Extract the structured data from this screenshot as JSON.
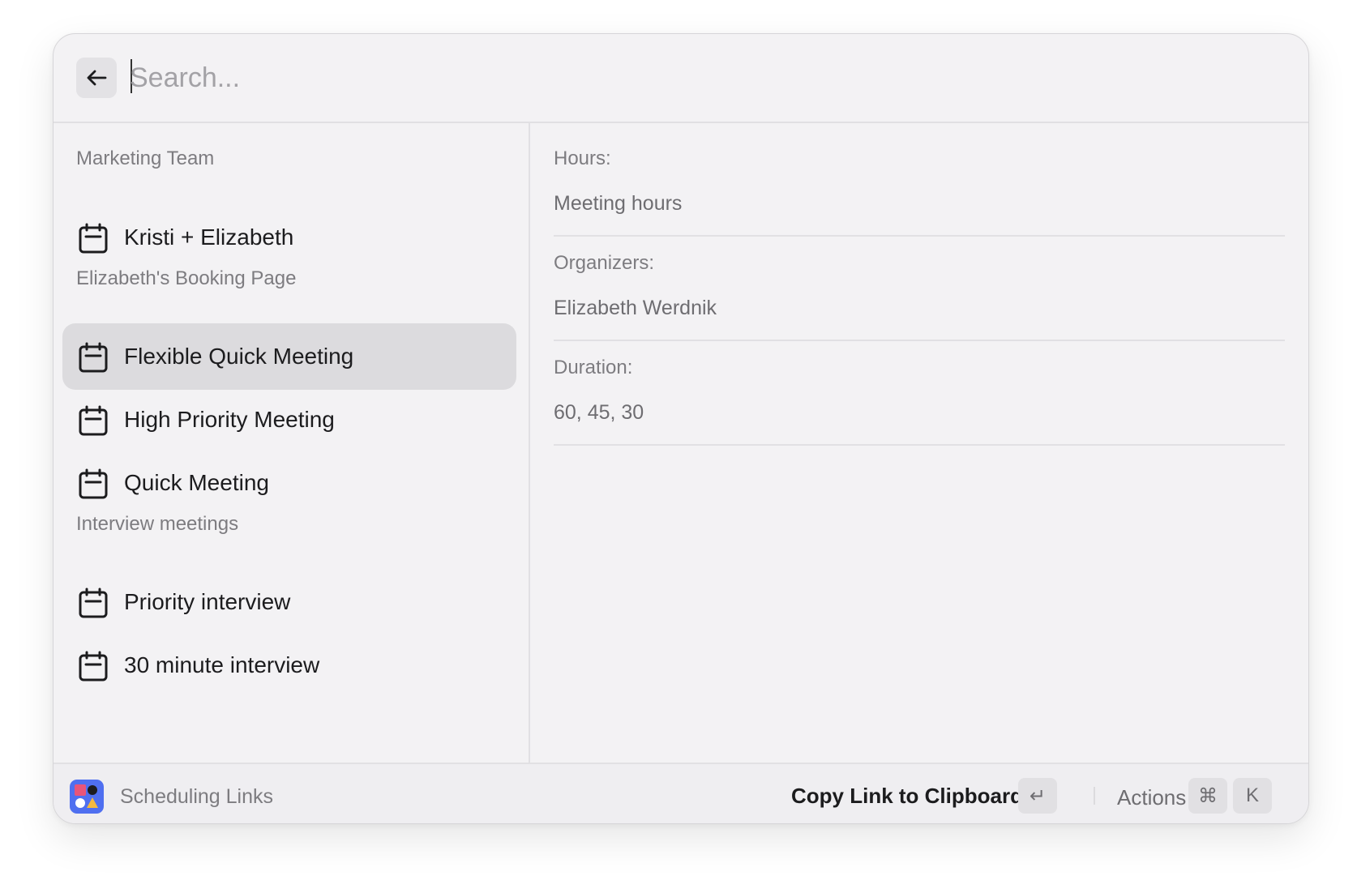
{
  "search": {
    "placeholder": "Search..."
  },
  "list": {
    "sections": [
      {
        "title": "Marketing Team",
        "items": [
          {
            "label": "Kristi + Elizabeth"
          }
        ]
      },
      {
        "title": "Elizabeth's Booking Page",
        "items": [
          {
            "label": "Flexible Quick Meeting",
            "selected": true
          },
          {
            "label": "High Priority Meeting"
          },
          {
            "label": "Quick Meeting"
          }
        ]
      },
      {
        "title": "Interview meetings",
        "items": [
          {
            "label": "Priority interview"
          },
          {
            "label": "30 minute interview"
          }
        ]
      }
    ]
  },
  "detail": {
    "hours_label": "Hours:",
    "hours_value": "Meeting hours",
    "organizers_label": "Organizers:",
    "organizers_value": "Elizabeth Werdnik",
    "duration_label": "Duration:",
    "duration_value": "60, 45, 30"
  },
  "footer": {
    "title": "Scheduling Links",
    "primary_action": "Copy Link to Clipboard",
    "enter_key": "↵",
    "actions_label": "Actions",
    "cmd_key": "⌘",
    "k_key": "K"
  },
  "colors": {
    "window_bg": "#f3f2f4",
    "selected_bg": "#dcdbde",
    "app_icon_bg": "#4f6ff0"
  }
}
